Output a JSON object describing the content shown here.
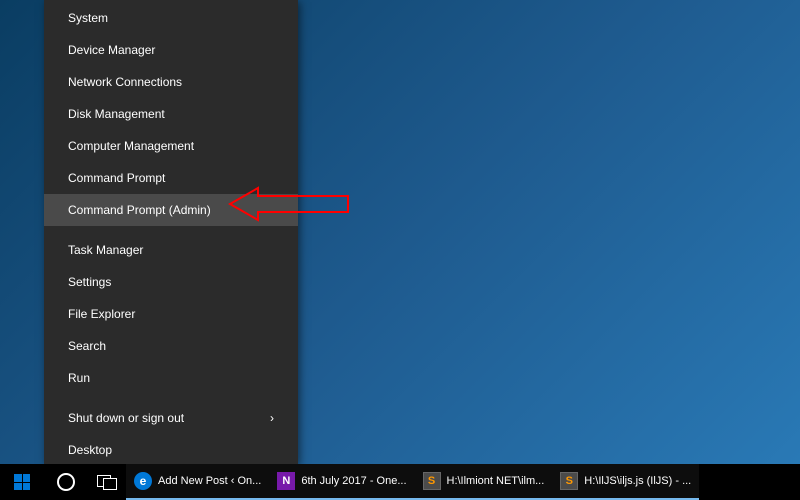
{
  "power_menu": {
    "items_top": [
      "System",
      "Device Manager",
      "Network Connections",
      "Disk Management",
      "Computer Management",
      "Command Prompt",
      "Command Prompt (Admin)"
    ],
    "items_mid": [
      "Task Manager",
      "Settings",
      "File Explorer",
      "Search",
      "Run"
    ],
    "items_bottom": [
      "Shut down or sign out",
      "Desktop"
    ],
    "highlighted_item": "Command Prompt (Admin)"
  },
  "taskbar": {
    "apps": [
      {
        "label": "Add New Post ‹ On...",
        "icon": "edge"
      },
      {
        "label": "6th July 2017 - One...",
        "icon": "onenote"
      },
      {
        "label": "H:\\Ilmiont NET\\ilm...",
        "icon": "sublime"
      },
      {
        "label": "H:\\IlJS\\iljs.js (IlJS) - ...",
        "icon": "sublime"
      }
    ]
  },
  "annotation": {
    "color": "#ff0000"
  }
}
